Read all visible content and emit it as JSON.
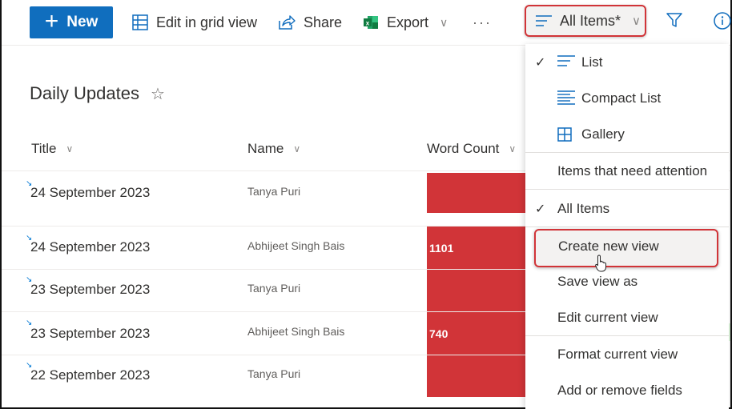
{
  "command_bar": {
    "new_label": "New",
    "edit_grid_label": "Edit in grid view",
    "share_label": "Share",
    "export_label": "Export",
    "more_label": "···",
    "view_selector_label": "All Items*",
    "icons": {
      "new": "plus-icon",
      "edit_grid": "grid-icon",
      "share": "share-icon",
      "export": "excel-icon",
      "view": "list-lines-icon",
      "filter": "filter-icon",
      "info": "info-icon"
    }
  },
  "list": {
    "title": "Daily Updates",
    "favorite_icon": "star-icon",
    "columns": [
      "Title",
      "Name",
      "Word Count"
    ],
    "rows": [
      {
        "title": "24  September 2023",
        "name": "Tanya Puri",
        "word_count": ""
      },
      {
        "title": "24  September 2023",
        "name": "Abhijeet Singh Bais",
        "word_count": "1101"
      },
      {
        "title": "23  September 2023",
        "name": "Tanya Puri",
        "word_count": ""
      },
      {
        "title": "23  September 2023",
        "name": "Abhijeet Singh Bais",
        "word_count": "740"
      },
      {
        "title": "22  September 2023",
        "name": "Tanya Puri",
        "word_count": ""
      }
    ],
    "word_count_color": "#d13438"
  },
  "view_menu": {
    "layouts": [
      {
        "label": "List",
        "icon": "list-icon",
        "checked": true
      },
      {
        "label": "Compact List",
        "icon": "compact-list-icon",
        "checked": false
      },
      {
        "label": "Gallery",
        "icon": "gallery-icon",
        "checked": false
      }
    ],
    "views": [
      {
        "label": "Items that need attention",
        "checked": false
      },
      {
        "label": "All Items",
        "checked": true
      }
    ],
    "actions": [
      {
        "label": "Create new view",
        "highlighted": true
      },
      {
        "label": "Save view as"
      },
      {
        "label": "Edit current view"
      }
    ],
    "format_actions": [
      {
        "label": "Format current view"
      },
      {
        "label": "Add or remove fields"
      }
    ],
    "check_glyph": "✓"
  },
  "colors": {
    "accent": "#106ebe",
    "highlight_border": "#d13438"
  }
}
